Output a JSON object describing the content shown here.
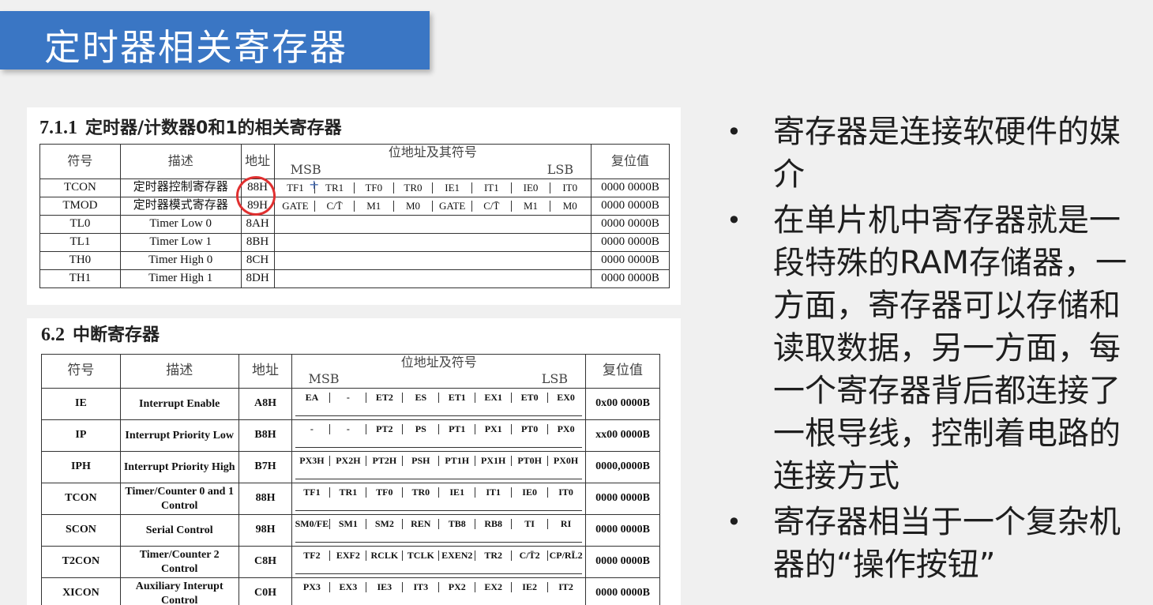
{
  "banner": {
    "title": "定时器相关寄存器"
  },
  "table1": {
    "title_num": "7.1.1",
    "title": "定时器/计数器0和1的相关寄存器",
    "headers": {
      "symbol": "符号",
      "desc": "描述",
      "addr": "地址",
      "bits": "位地址及其符号",
      "msb": "MSB",
      "lsb": "LSB",
      "reset": "复位值"
    },
    "rows": [
      {
        "symbol": "TCON",
        "desc": "定时器控制寄存器",
        "addr": "88H",
        "bits": [
          "TF1",
          "TR1",
          "TF0",
          "TR0",
          "IE1",
          "IT1",
          "IE0",
          "IT0"
        ],
        "reset": "0000 0000B"
      },
      {
        "symbol": "TMOD",
        "desc": "定时器模式寄存器",
        "addr": "89H",
        "bits": [
          "GATE",
          "C/T̄",
          "M1",
          "M0",
          "GATE",
          "C/T̄",
          "M1",
          "M0"
        ],
        "reset": "0000 0000B"
      },
      {
        "symbol": "TL0",
        "desc": "Timer Low 0",
        "addr": "8AH",
        "bits": [],
        "reset": "0000 0000B"
      },
      {
        "symbol": "TL1",
        "desc": "Timer Low 1",
        "addr": "8BH",
        "bits": [],
        "reset": "0000 0000B"
      },
      {
        "symbol": "TH0",
        "desc": "Timer High 0",
        "addr": "8CH",
        "bits": [],
        "reset": "0000 0000B"
      },
      {
        "symbol": "TH1",
        "desc": "Timer High 1",
        "addr": "8DH",
        "bits": [],
        "reset": "0000 0000B"
      }
    ]
  },
  "table2": {
    "title_num": "6.2",
    "title": "中断寄存器",
    "headers": {
      "symbol": "符号",
      "desc": "描述",
      "addr": "地址",
      "bits": "位地址及符号",
      "msb": "MSB",
      "lsb": "LSB",
      "reset": "复位值"
    },
    "rows": [
      {
        "symbol": "IE",
        "desc": "Interrupt Enable",
        "addr": "A8H",
        "bits": [
          "EA",
          "-",
          "ET2",
          "ES",
          "ET1",
          "EX1",
          "ET0",
          "EX0"
        ],
        "reset": "0x00 0000B"
      },
      {
        "symbol": "IP",
        "desc": "Interrupt Priority Low",
        "addr": "B8H",
        "bits": [
          "-",
          "-",
          "PT2",
          "PS",
          "PT1",
          "PX1",
          "PT0",
          "PX0"
        ],
        "reset": "xx00 0000B"
      },
      {
        "symbol": "IPH",
        "desc": "Interrupt Priority High",
        "addr": "B7H",
        "bits": [
          "PX3H",
          "PX2H",
          "PT2H",
          "PSH",
          "PT1H",
          "PX1H",
          "PT0H",
          "PX0H"
        ],
        "reset": "0000,0000B"
      },
      {
        "symbol": "TCON",
        "desc": "Timer/Counter 0 and 1 Control",
        "addr": "88H",
        "bits": [
          "TF1",
          "TR1",
          "TF0",
          "TR0",
          "IE1",
          "IT1",
          "IE0",
          "IT0"
        ],
        "reset": "0000 0000B"
      },
      {
        "symbol": "SCON",
        "desc": "Serial Control",
        "addr": "98H",
        "bits": [
          "SM0/FE",
          "SM1",
          "SM2",
          "REN",
          "TB8",
          "RB8",
          "TI",
          "RI"
        ],
        "reset": "0000 0000B"
      },
      {
        "symbol": "T2CON",
        "desc": "Timer/Counter 2 Control",
        "addr": "C8H",
        "bits": [
          "TF2",
          "EXF2",
          "RCLK",
          "TCLK",
          "EXEN2",
          "TR2",
          "C/T̄2",
          "CP/RL̄2"
        ],
        "reset": "0000 0000B"
      },
      {
        "symbol": "XICON",
        "desc": "Auxiliary Interupt Control",
        "addr": "C0H",
        "bits": [
          "PX3",
          "EX3",
          "IE3",
          "IT3",
          "PX2",
          "EX2",
          "IE2",
          "IT2"
        ],
        "reset": "0000 0000B"
      }
    ]
  },
  "bullets": [
    "寄存器是连接软硬件的媒介",
    "在单片机中寄存器就是一段特殊的RAM存储器，一方面，寄存器可以存储和读取数据，另一方面，每一个寄存器背后都连接了一根导线，控制着电路的连接方式",
    "寄存器相当于一个复杂机器的“操作按钮”"
  ],
  "colors": {
    "banner": "#3a76c4",
    "annotation": "#e03030"
  }
}
